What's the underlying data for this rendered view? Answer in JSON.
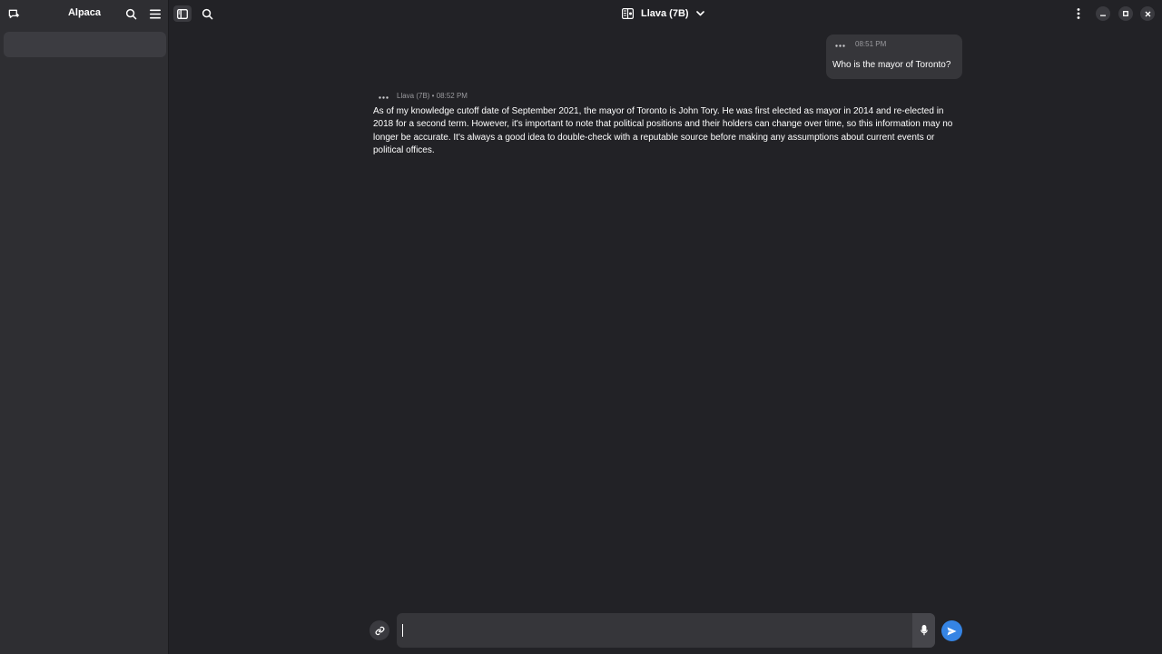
{
  "app": {
    "title": "Alpaca"
  },
  "sidebar": {
    "icons": {
      "new_chat": "new-chat-icon",
      "search": "search-icon",
      "menu": "hamburger-menu-icon"
    },
    "chats": [
      {
        "label": ""
      }
    ]
  },
  "header": {
    "model_name": "Llava (7B)",
    "icons": {
      "toggle_sidebar": "sidebar-toggle-icon",
      "search": "search-icon",
      "model_manager": "model-manager-icon",
      "dropdown": "chevron-down-icon",
      "menu": "kebab-menu-icon",
      "minimize": "minimize-icon",
      "maximize": "maximize-icon",
      "close": "close-icon"
    }
  },
  "messages": {
    "user": {
      "time": "08:51 PM",
      "text": "Who is the mayor of Toronto?"
    },
    "bot": {
      "meta": "Llava (7B) • 08:52 PM",
      "text": " As of my knowledge cutoff date of September 2021, the mayor of Toronto is John Tory. He was first elected as mayor in 2014 and re-elected in 2018 for a second term. However, it's important to note that political positions and their holders can change over time, so this information may no longer be accurate. It's always a good idea to double-check with a reputable source before making any assumptions about current events or political offices."
    }
  },
  "input": {
    "value": "",
    "placeholder": ""
  },
  "colors": {
    "background": "#222226",
    "sidebar": "#2e2e32",
    "bubble": "#36363a",
    "accent": "#3584e4",
    "muted_text": "#9a9a9e"
  }
}
